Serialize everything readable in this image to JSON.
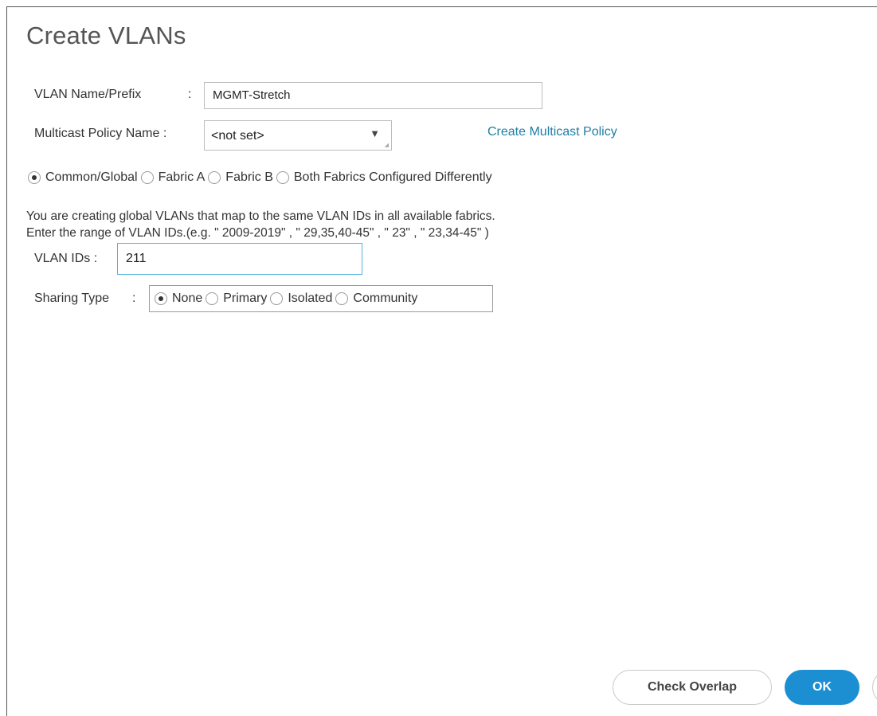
{
  "dialog": {
    "title": "Create VLANs"
  },
  "form": {
    "vlan_name_label": "VLAN Name/Prefix",
    "vlan_name_colon": ":",
    "vlan_name_value": "MGMT-Stretch",
    "multicast_label": "Multicast Policy Name :",
    "multicast_value": "<not set>",
    "create_multicast_link": "Create Multicast Policy",
    "fabric_options": [
      {
        "label": "Common/Global",
        "checked": true
      },
      {
        "label": "Fabric A",
        "checked": false
      },
      {
        "label": "Fabric B",
        "checked": false
      },
      {
        "label": "Both Fabrics Configured Differently",
        "checked": false
      }
    ],
    "info_line1": "You are creating global VLANs that map to the same VLAN IDs in all available fabrics.",
    "info_line2": "Enter the range of VLAN IDs.(e.g. \" 2009-2019\" , \" 29,35,40-45\" , \" 23\" , \" 23,34-45\" )",
    "vlan_ids_label": "VLAN IDs :",
    "vlan_ids_value": "211",
    "sharing_label": "Sharing Type",
    "sharing_colon": ":",
    "sharing_options": [
      {
        "label": "None",
        "checked": true
      },
      {
        "label": "Primary",
        "checked": false
      },
      {
        "label": "Isolated",
        "checked": false
      },
      {
        "label": "Community",
        "checked": false
      }
    ]
  },
  "footer": {
    "check_overlap_label": "Check Overlap",
    "ok_label": "OK"
  },
  "colors": {
    "primary_button": "#1c8fd3",
    "link": "#1f7fa6",
    "focus_border": "#57b1dd"
  }
}
